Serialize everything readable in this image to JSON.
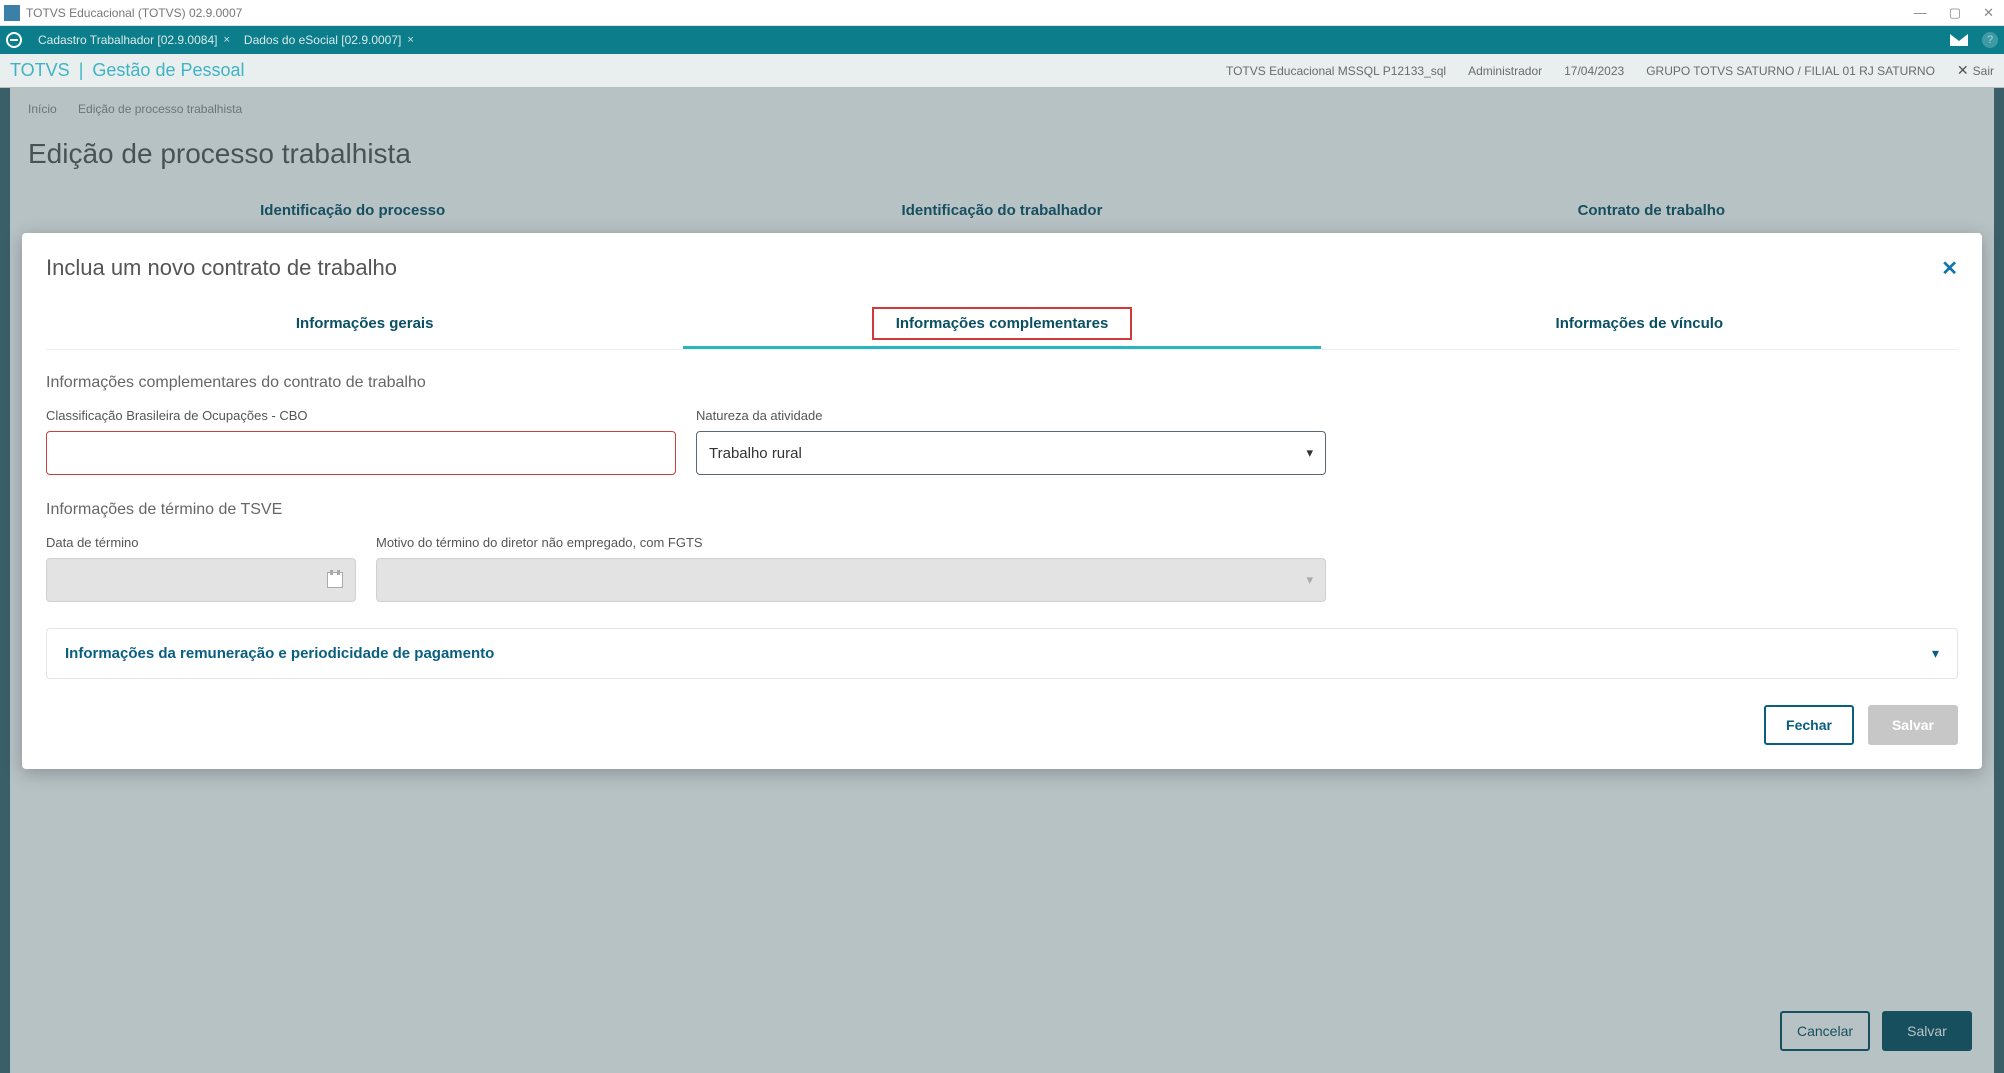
{
  "window": {
    "title": "TOTVS Educacional (TOTVS) 02.9.0007"
  },
  "tabbar": {
    "tabs": [
      {
        "label": "Cadastro Trabalhador [02.9.0084]"
      },
      {
        "label": "Dados do eSocial [02.9.0007]",
        "active": true
      }
    ]
  },
  "header": {
    "brand_prefix": "TOTVS",
    "brand_separator": "|",
    "brand_suffix": "Gestão de Pessoal",
    "env": "TOTVS Educacional MSSQL P12133_sql",
    "user": "Administrador",
    "date": "17/04/2023",
    "org": "GRUPO TOTVS SATURNO / FILIAL 01 RJ SATURNO",
    "exit_label": "Sair"
  },
  "page": {
    "breadcrumb_home": "Início",
    "breadcrumb_current": "Edição de processo trabalhista",
    "title": "Edição de processo trabalhista",
    "tabs": [
      {
        "label": "Identificação do processo"
      },
      {
        "label": "Identificação do trabalhador"
      },
      {
        "label": "Contrato de trabalho",
        "active": true
      }
    ],
    "actions": {
      "cancel": "Cancelar",
      "save": "Salvar"
    }
  },
  "modal": {
    "title": "Inclua um novo contrato de trabalho",
    "tabs": [
      {
        "label": "Informações gerais"
      },
      {
        "label": "Informações complementares",
        "active": true,
        "highlight": true
      },
      {
        "label": "Informações de vínculo"
      }
    ],
    "section1_heading": "Informações complementares do contrato de trabalho",
    "fields": {
      "cbo": {
        "label": "Classificação Brasileira de Ocupações - CBO",
        "value": ""
      },
      "natureza": {
        "label": "Natureza da atividade",
        "value": "Trabalho rural"
      }
    },
    "section2_heading": "Informações de término de TSVE",
    "fields2": {
      "data_termino": {
        "label": "Data de término",
        "value": ""
      },
      "motivo": {
        "label": "Motivo do término do diretor não empregado, com FGTS",
        "value": ""
      }
    },
    "accordion_title": "Informações da remuneração e periodicidade de pagamento",
    "actions": {
      "close": "Fechar",
      "save": "Salvar"
    }
  }
}
